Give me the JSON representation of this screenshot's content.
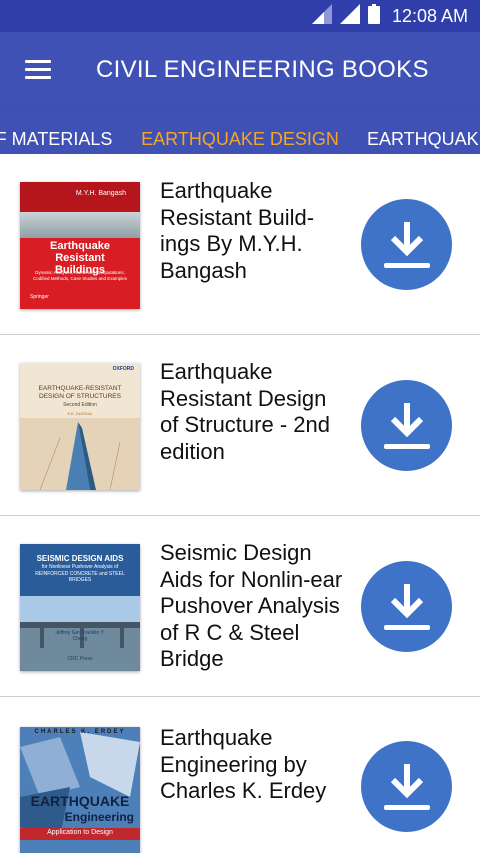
{
  "status_bar": {
    "time": "12:08 AM",
    "icons": [
      "signal-weak-icon",
      "signal-icon",
      "battery-icon"
    ]
  },
  "app_bar": {
    "menu_icon": "hamburger-menu-icon",
    "title": "CIVIL ENGINEERING BOOKS"
  },
  "tabs": [
    {
      "label": "F MATERIALS",
      "selected": false
    },
    {
      "label": "EARTHQUAKE DESIGN",
      "selected": true
    },
    {
      "label": "EARTHQUAKE",
      "selected": false
    }
  ],
  "colors": {
    "status_bar": "#2f3ea8",
    "primary": "#3f51b5",
    "selected_tab": "#f5a623",
    "download_button": "#3e73c8"
  },
  "books": [
    {
      "title": "Earthquake Resistant Build-ings By M.Y.H. Bangash",
      "cover": {
        "author": "M.Y.H. Bangash",
        "title": "Earthquake Resistant Buildings",
        "subtitle": "Dynamic Analyses, Numerical Computations, Codified Methods, Case Studies and Examples",
        "publisher": "Springer"
      },
      "action_icon": "download-icon"
    },
    {
      "title": "Earthquake Resistant Design of Structure - 2nd edition",
      "cover": {
        "publisher": "OXFORD",
        "title": "EARTHQUAKE-RESISTANT DESIGN OF STRUCTURES",
        "edition": "Second Edition",
        "author": "S.K. DUGGAL"
      },
      "action_icon": "download-icon"
    },
    {
      "title": "Seismic Design Aids for Nonlin-ear Pushover Analysis of R C & Steel Bridge",
      "cover": {
        "title": "SEISMIC DESIGN AIDS",
        "subtitle": "for Nonlinear Pushover Analysis of REINFORCED CONCRETE and STEEL BRIDGES",
        "author": "Jeffrey Ger Franklin Y. Cheng",
        "publisher": "CRC Press"
      },
      "action_icon": "download-icon"
    },
    {
      "title": "Earthquake Engineering by Charles K. Erdey",
      "cover": {
        "author": "CHARLES K. ERDEY",
        "title": "EARTHQUAKE",
        "title2": "Engineering",
        "subtitle": "Application to Design"
      },
      "action_icon": "download-icon"
    }
  ]
}
